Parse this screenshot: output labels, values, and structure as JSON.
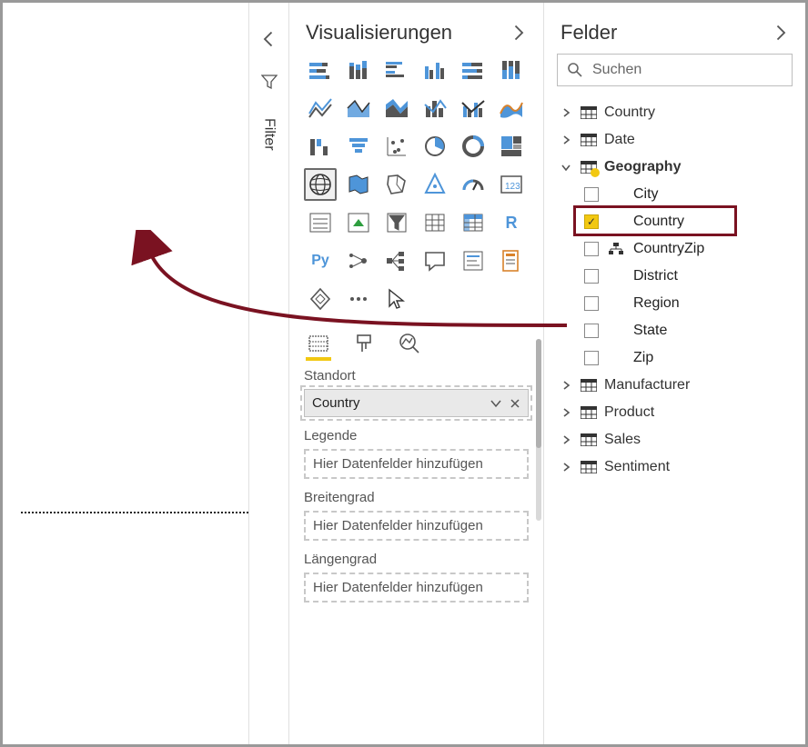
{
  "filter_pane": {
    "label": "Filter"
  },
  "visualizations": {
    "title": "Visualisierungen",
    "selected_icon": "map",
    "wells": {
      "location": {
        "label": "Standort",
        "value": "Country"
      },
      "legend": {
        "label": "Legende",
        "placeholder": "Hier Datenfelder hinzufügen"
      },
      "latitude": {
        "label": "Breitengrad",
        "placeholder": "Hier Datenfelder hinzufügen"
      },
      "longitude": {
        "label": "Längengrad",
        "placeholder": "Hier Datenfelder hinzufügen"
      }
    },
    "code_labels": {
      "r": "R",
      "py": "Py"
    }
  },
  "fields": {
    "title": "Felder",
    "search_placeholder": "Suchen",
    "tables": [
      {
        "name": "Country",
        "expanded": false
      },
      {
        "name": "Date",
        "expanded": false
      },
      {
        "name": "Geography",
        "expanded": true,
        "warn": true,
        "columns": [
          {
            "name": "City",
            "checked": false
          },
          {
            "name": "Country",
            "checked": true,
            "highlight": true
          },
          {
            "name": "CountryZip",
            "checked": false,
            "hierarchy": true
          },
          {
            "name": "District",
            "checked": false
          },
          {
            "name": "Region",
            "checked": false
          },
          {
            "name": "State",
            "checked": false
          },
          {
            "name": "Zip",
            "checked": false
          }
        ]
      },
      {
        "name": "Manufacturer",
        "expanded": false
      },
      {
        "name": "Product",
        "expanded": false
      },
      {
        "name": "Sales",
        "expanded": false
      },
      {
        "name": "Sentiment",
        "expanded": false
      }
    ]
  }
}
